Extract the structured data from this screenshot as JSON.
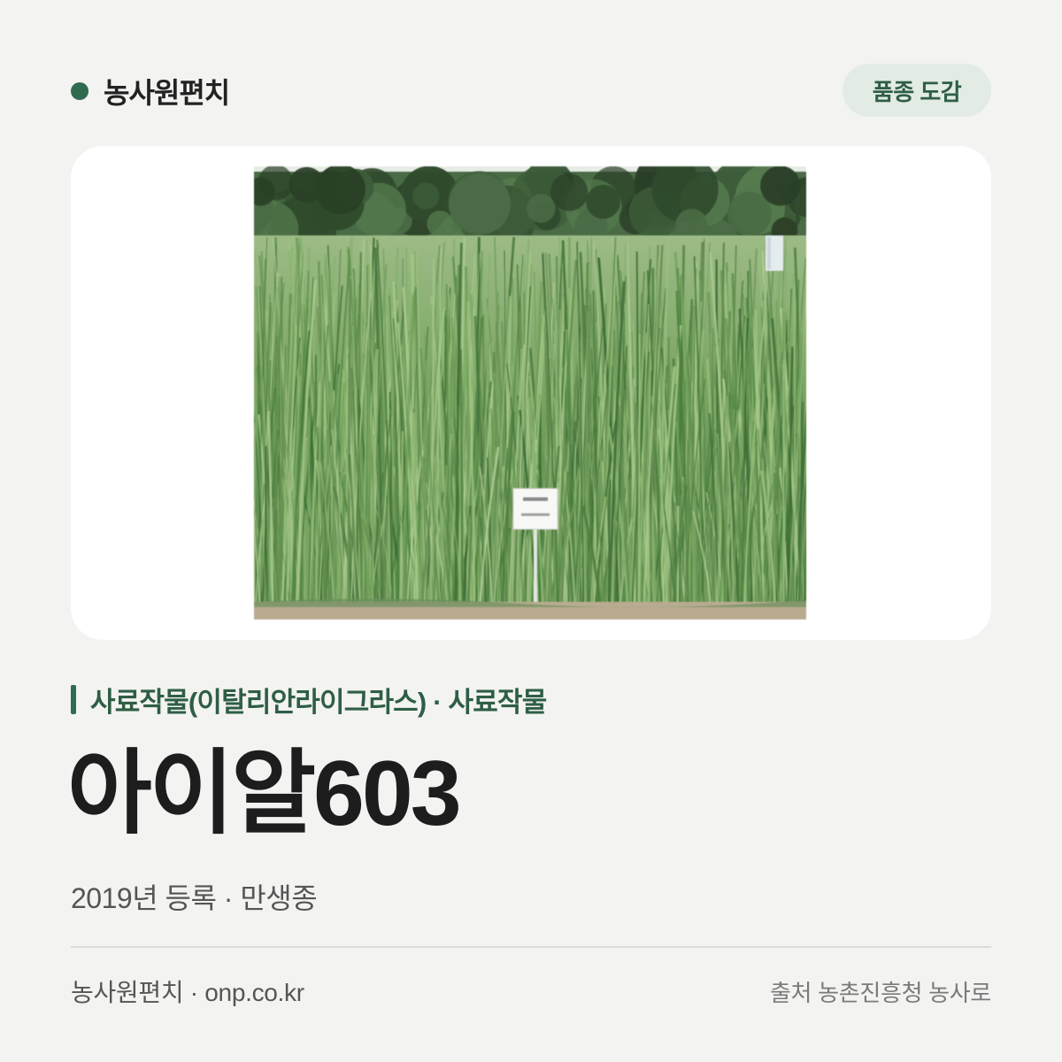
{
  "brand": {
    "name": "농사원편치"
  },
  "badge": {
    "label": "품종 도감"
  },
  "variety": {
    "category": "사료작물(이탈리안라이그라스) · 사료작물",
    "name": "아이알603",
    "meta": "2019년 등록 · 만생종"
  },
  "footer": {
    "site": "농사원편치 · onp.co.kr",
    "source": "출처 농촌진흥청 농사로"
  },
  "colors": {
    "accent": "#2e6b4f",
    "background": "#f3f3f1",
    "badge_background": "#e3ebe5",
    "card": "#ffffff"
  }
}
